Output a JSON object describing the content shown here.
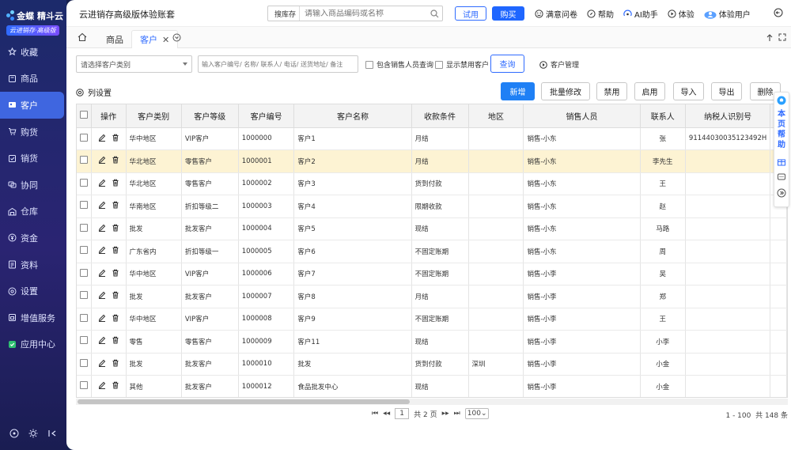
{
  "brand": {
    "name": "金蝶 精斗云",
    "badge": "云进销存·高级版"
  },
  "nav": [
    {
      "label": "收藏",
      "icon": "star-icon"
    },
    {
      "label": "商品",
      "icon": "goods-icon"
    },
    {
      "label": "客户",
      "icon": "customer-icon",
      "active": true
    },
    {
      "label": "购货",
      "icon": "cart-icon"
    },
    {
      "label": "销货",
      "icon": "sales-icon"
    },
    {
      "label": "协同",
      "icon": "collab-icon"
    },
    {
      "label": "仓库",
      "icon": "warehouse-icon"
    },
    {
      "label": "资金",
      "icon": "money-icon"
    },
    {
      "label": "资料",
      "icon": "data-icon"
    },
    {
      "label": "设置",
      "icon": "settings-icon"
    },
    {
      "label": "增值服务",
      "icon": "vas-icon"
    },
    {
      "label": "应用中心",
      "icon": "app-center-icon"
    }
  ],
  "header": {
    "title": "云进销存高级版体验账套",
    "search_label": "搜库存",
    "search_placeholder": "请输入商品编码或名称",
    "try_label": "试用",
    "buy_label": "购买",
    "links": {
      "survey": "满意问卷",
      "help": "帮助",
      "ai": "AI助手",
      "trial": "体验",
      "user": "体验用户"
    }
  },
  "tabs": {
    "goods": "商品",
    "customer": "客户"
  },
  "filters": {
    "category_placeholder": "请选择客户类别",
    "keyword_placeholder": "输入客户编号/ 名称/ 联系人/ 电话/ 送货地址/ 备注",
    "include_sales_label": "包含销售人员查询",
    "show_disabled_label": "显示禁用客户",
    "query_label": "查询",
    "manage_label": "客户管理"
  },
  "toolbar": {
    "column_settings": "列设置",
    "add": "新增",
    "batch_edit": "批量修改",
    "disable": "禁用",
    "enable": "启用",
    "import": "导入",
    "export": "导出",
    "delete": "删除"
  },
  "table": {
    "columns": [
      "操作",
      "客户类别",
      "客户等级",
      "客户编号",
      "客户名称",
      "收款条件",
      "地区",
      "销售人员",
      "联系人",
      "纳税人识别号"
    ],
    "rows": [
      {
        "category": "华中地区",
        "level": "VIP客户",
        "code": "1000000",
        "name": "客户1",
        "terms": "月结",
        "region": "",
        "sales": "销售-小东",
        "contact": "张",
        "taxid": "91144030035123492H"
      },
      {
        "category": "华北地区",
        "level": "零售客户",
        "code": "1000001",
        "name": "客户2",
        "terms": "月结",
        "region": "",
        "sales": "销售-小东",
        "contact": "李先生",
        "taxid": ""
      },
      {
        "category": "华北地区",
        "level": "零售客户",
        "code": "1000002",
        "name": "客户3",
        "terms": "货到付款",
        "region": "",
        "sales": "销售-小东",
        "contact": "王",
        "taxid": ""
      },
      {
        "category": "华南地区",
        "level": "折扣等级二",
        "code": "1000003",
        "name": "客户4",
        "terms": "限期收款",
        "region": "",
        "sales": "销售-小东",
        "contact": "赵",
        "taxid": ""
      },
      {
        "category": "批发",
        "level": "批发客户",
        "code": "1000004",
        "name": "客户5",
        "terms": "现结",
        "region": "",
        "sales": "销售-小东",
        "contact": "马路",
        "taxid": ""
      },
      {
        "category": "广东省内",
        "level": "折扣等级一",
        "code": "1000005",
        "name": "客户6",
        "terms": "不固定账期",
        "region": "",
        "sales": "销售-小东",
        "contact": "周",
        "taxid": ""
      },
      {
        "category": "华中地区",
        "level": "VIP客户",
        "code": "1000006",
        "name": "客户7",
        "terms": "不固定账期",
        "region": "",
        "sales": "销售-小李",
        "contact": "吴",
        "taxid": ""
      },
      {
        "category": "批发",
        "level": "批发客户",
        "code": "1000007",
        "name": "客户8",
        "terms": "月结",
        "region": "",
        "sales": "销售-小李",
        "contact": "郑",
        "taxid": ""
      },
      {
        "category": "华中地区",
        "level": "VIP客户",
        "code": "1000008",
        "name": "客户9",
        "terms": "不固定账期",
        "region": "",
        "sales": "销售-小李",
        "contact": "王",
        "taxid": ""
      },
      {
        "category": "零售",
        "level": "零售客户",
        "code": "1000009",
        "name": "客户11",
        "terms": "现结",
        "region": "",
        "sales": "销售-小李",
        "contact": "小李",
        "taxid": ""
      },
      {
        "category": "批发",
        "level": "批发客户",
        "code": "1000010",
        "name": "批发",
        "terms": "货到付款",
        "region": "深圳",
        "sales": "销售-小李",
        "contact": "小金",
        "taxid": ""
      },
      {
        "category": "其他",
        "level": "批发客户",
        "code": "1000012",
        "name": "食品批发中心",
        "terms": "现结",
        "region": "",
        "sales": "销售-小李",
        "contact": "小金",
        "taxid": ""
      }
    ]
  },
  "pagination": {
    "current": "1",
    "total_pages": "共 2 页",
    "page_size": "100",
    "range": "1 - 100",
    "total": "共 148 条"
  },
  "help_panel": {
    "title": "本页帮助"
  },
  "colors": {
    "primary": "#1f66ff",
    "sidebar": "#1c2a6b",
    "highlight_row": "#fdf3d3"
  }
}
